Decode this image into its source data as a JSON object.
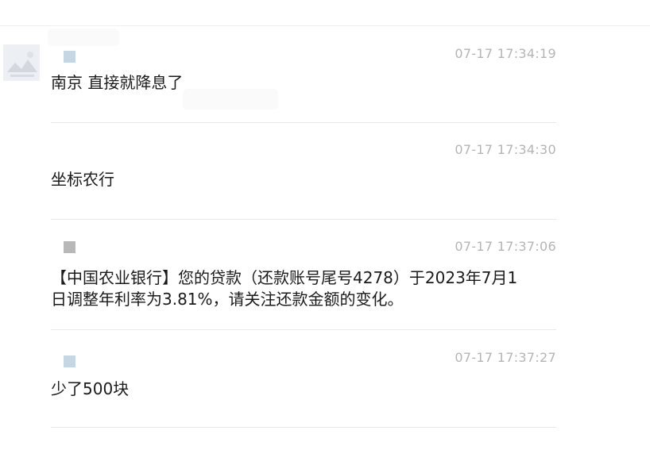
{
  "messages": [
    {
      "id": 1,
      "timestamp": "07-17 17:34:19",
      "text": "南京 直接就降息了",
      "has_avatar": true,
      "user_mark_color": "#c7d6e4"
    },
    {
      "id": 2,
      "timestamp": "07-17 17:34:30",
      "text": "坐标农行",
      "has_avatar": false,
      "user_mark_color": null
    },
    {
      "id": 3,
      "timestamp": "07-17 17:37:06",
      "text": "【中国农业银行】您的贷款（还款账号尾号4278）于2023年7月1日调整年利率为3.81%，请关注还款金额的变化。",
      "has_avatar": false,
      "user_mark_color": "#b8b8b8"
    },
    {
      "id": 4,
      "timestamp": "07-17 17:37:27",
      "text": "少了500块",
      "has_avatar": false,
      "user_mark_color": "#c7d6e4"
    }
  ],
  "avatar": {
    "icon": "image-placeholder-icon",
    "background": "#e9ecf0"
  },
  "colors": {
    "text": "#1a1a1a",
    "timestamp": "#b4b4b4",
    "divider": "#e8e8e8",
    "background": "#ffffff"
  }
}
